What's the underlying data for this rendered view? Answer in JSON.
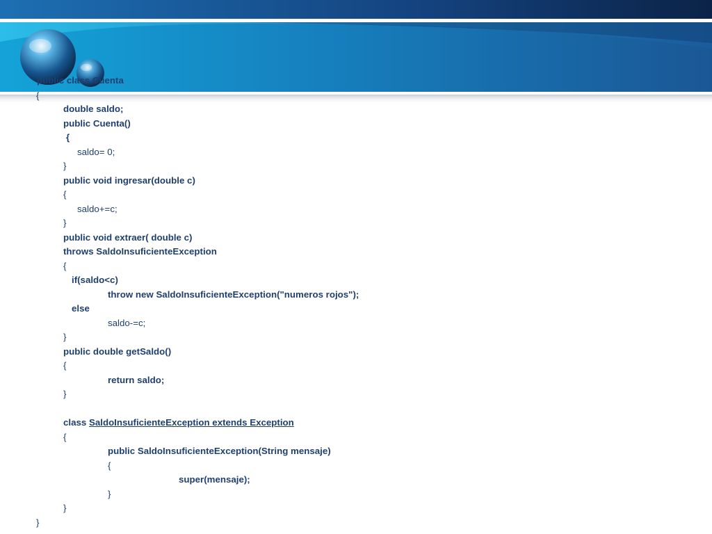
{
  "colors": {
    "banner_dark": "#0d2a55",
    "banner_mid": "#1e6fb0",
    "banner_light": "#1499d2",
    "code_text": "#1f3f6e",
    "background": "#ffffff"
  },
  "decor": {
    "large_orb": "sphere-orb",
    "small_orb": "sphere-orb"
  },
  "code": {
    "l01": "public class Cuenta",
    "l02": "{",
    "l03": "double saldo;",
    "l04": "public Cuenta()",
    "l05": "{",
    "l06": "saldo= 0;",
    "l07": "}",
    "l08": "public void ingresar(double c)",
    "l09": "{",
    "l10": "saldo+=c;",
    "l11": "}",
    "l12": "public void extraer( double c)",
    "l13": "throws SaldoInsuficienteException",
    "l14": "{",
    "l15": "if(saldo<c)",
    "l16": "throw new SaldoInsuficienteException(\"numeros rojos\");",
    "l17": "else",
    "l18": "saldo-=c;",
    "l19": "}",
    "l20": "public double getSaldo()",
    "l21": "{",
    "l22": "return saldo;",
    "l23": "}",
    "l24_kw": "class ",
    "l24_rest": "SaldoInsuficienteException extends Exception",
    "l25": "{",
    "l26": "public SaldoInsuficienteException(String mensaje)",
    "l27": "{",
    "l28": "super(mensaje);",
    "l29": "}",
    "l30": "}",
    "l31": "}"
  }
}
